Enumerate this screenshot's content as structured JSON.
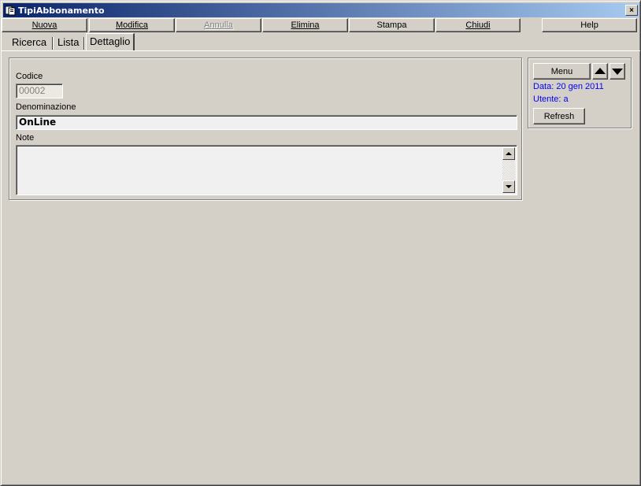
{
  "window": {
    "title": "TipiAbbonamento",
    "close_label": "×"
  },
  "toolbar": {
    "nuova": "Nuova",
    "modifica": "Modifica",
    "annulla": "Annulla",
    "elimina": "Elimina",
    "stampa": "Stampa",
    "chiudi": "Chiudi",
    "help": "Help"
  },
  "tabs": {
    "ricerca": "Ricerca",
    "lista": "Lista",
    "dettaglio": "Dettaglio",
    "active": "Dettaglio"
  },
  "form": {
    "codice_label": "Codice",
    "codice_value": "00002",
    "denominazione_label": "Denominazione",
    "denominazione_value": "OnLine",
    "note_label": "Note",
    "note_value": ""
  },
  "side_panel": {
    "menu_label": "Menu",
    "data_text": "Data: 20 gen 2011",
    "utente_text": "Utente: a",
    "refresh_label": "Refresh"
  },
  "colors": {
    "face": "#d4d0c8",
    "titlebar_start": "#0a246a",
    "titlebar_end": "#a6caf0",
    "info_text": "#0000ff"
  }
}
